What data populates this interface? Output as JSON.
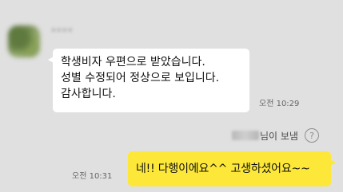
{
  "incoming": {
    "sender_name": "••••",
    "message_lines": [
      "학생비자 우편으로 받았습니다.",
      "성별 수정되어 정상으로 보입니다.",
      "감사합니다."
    ],
    "time": "오전 10:29"
  },
  "forward_notice": {
    "suffix": "님이 보냄",
    "help_icon": "question-circle-icon",
    "help_glyph": "?"
  },
  "outgoing": {
    "message": "네!! 다행이에요^^ 고생하셨어요~~",
    "time": "오전 10:31"
  },
  "colors": {
    "background": "#e0e0e0",
    "incoming_bubble": "#ffffff",
    "outgoing_bubble": "#fde839"
  }
}
